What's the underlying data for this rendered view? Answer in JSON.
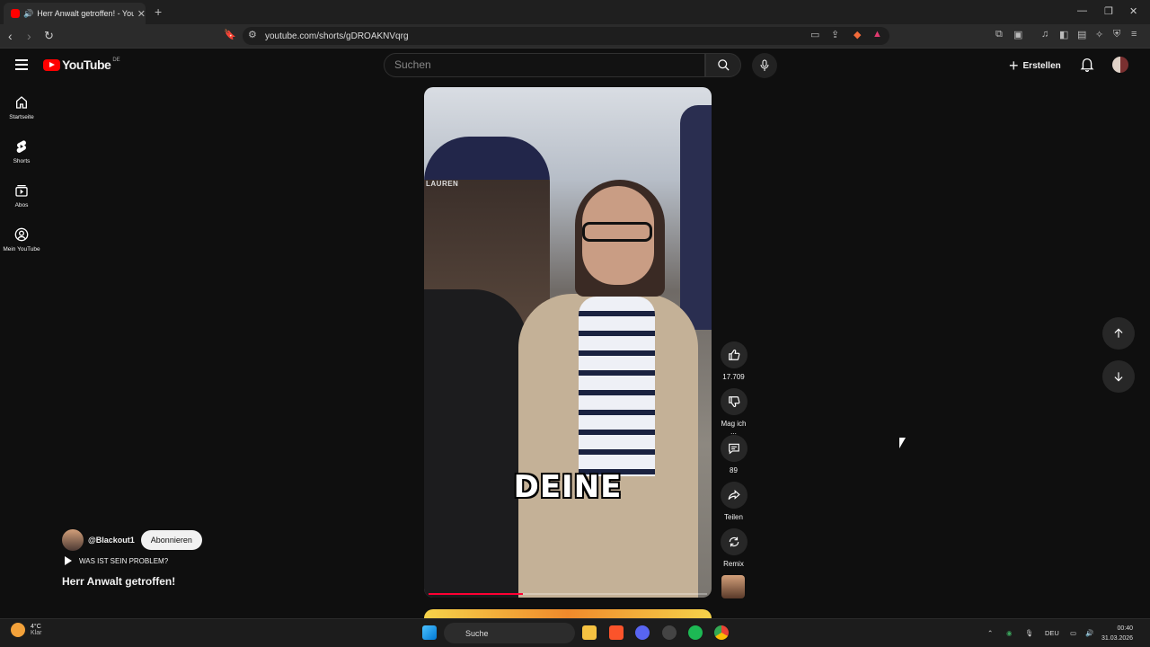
{
  "browser": {
    "tab_title": "Herr Anwalt getroffen! - YouT",
    "url": "youtube.com/shorts/gDROAKNVqrg"
  },
  "header": {
    "logo_text": "YouTube",
    "region": "DE",
    "search_placeholder": "Suchen",
    "create_label": "Erstellen"
  },
  "sidebar": {
    "items": [
      {
        "label": "Startseite",
        "icon": "home-icon"
      },
      {
        "label": "Shorts",
        "icon": "shorts-icon"
      },
      {
        "label": "Abos",
        "icon": "subscriptions-icon"
      },
      {
        "label": "Mein YouTube",
        "icon": "account-icon"
      }
    ]
  },
  "video": {
    "caption": "DEINE",
    "store_text": "LAUREN",
    "progress": 0.34
  },
  "actions": {
    "like_count": "17.709",
    "dislike_label": "Mag ich ...",
    "comment_count": "89",
    "share_label": "Teilen",
    "remix_label": "Remix"
  },
  "info": {
    "channel": "@Blackout1",
    "subscribe_label": "Abonnieren",
    "music": "WAS IST SEIN PROBLEM?",
    "title": "Herr Anwalt getroffen!"
  },
  "taskbar": {
    "temperature": "4°C",
    "weather": "Klar",
    "search_label": "Suche",
    "language": "DEU",
    "time": "00:40",
    "date": "31.03.2026"
  }
}
